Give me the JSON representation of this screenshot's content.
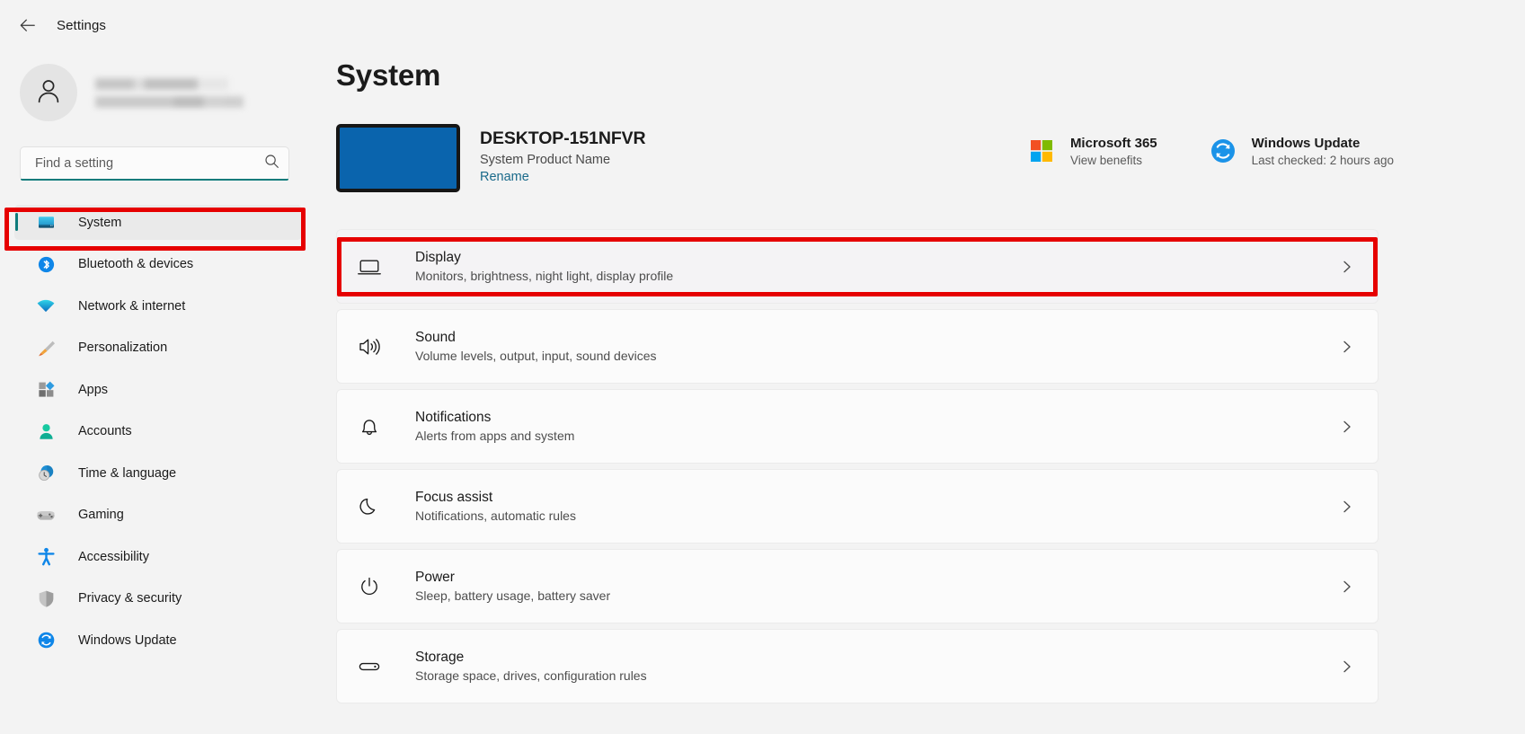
{
  "titlebar": {
    "back_icon": "back-arrow-icon",
    "title": "Settings"
  },
  "sidebar": {
    "account": {
      "avatar_icon": "person-avatar-icon",
      "name_redacted": "",
      "email_redacted": ""
    },
    "search": {
      "placeholder": "Find a setting",
      "value": "",
      "icon": "search-icon"
    },
    "items": [
      {
        "label": "System",
        "icon": "monitor-icon",
        "selected": true
      },
      {
        "label": "Bluetooth & devices",
        "icon": "bluetooth-icon",
        "selected": false
      },
      {
        "label": "Network & internet",
        "icon": "wifi-icon",
        "selected": false
      },
      {
        "label": "Personalization",
        "icon": "paintbrush-icon",
        "selected": false
      },
      {
        "label": "Apps",
        "icon": "apps-grid-icon",
        "selected": false
      },
      {
        "label": "Accounts",
        "icon": "person-icon",
        "selected": false
      },
      {
        "label": "Time & language",
        "icon": "clock-globe-icon",
        "selected": false
      },
      {
        "label": "Gaming",
        "icon": "gamepad-icon",
        "selected": false
      },
      {
        "label": "Accessibility",
        "icon": "accessibility-icon",
        "selected": false
      },
      {
        "label": "Privacy & security",
        "icon": "shield-icon",
        "selected": false
      },
      {
        "label": "Windows Update",
        "icon": "update-refresh-icon",
        "selected": false
      }
    ]
  },
  "main": {
    "page_title": "System",
    "device": {
      "thumbnail_icon": "monitor-preview-icon",
      "name": "DESKTOP-151NFVR",
      "product": "System Product Name",
      "rename_label": "Rename"
    },
    "widgets": [
      {
        "icon": "microsoft-logo-icon",
        "title": "Microsoft 365",
        "subtitle": "View benefits"
      },
      {
        "icon": "windows-update-icon",
        "title": "Windows Update",
        "subtitle": "Last checked: 2 hours ago"
      }
    ],
    "cards": [
      {
        "icon": "display-monitor-icon",
        "title": "Display",
        "subtitle": "Monitors, brightness, night light, display profile",
        "chevron": "chevron-right-icon",
        "highlighted": true
      },
      {
        "icon": "sound-speaker-icon",
        "title": "Sound",
        "subtitle": "Volume levels, output, input, sound devices",
        "chevron": "chevron-right-icon",
        "highlighted": false
      },
      {
        "icon": "notification-bell-icon",
        "title": "Notifications",
        "subtitle": "Alerts from apps and system",
        "chevron": "chevron-right-icon",
        "highlighted": false
      },
      {
        "icon": "focus-moon-icon",
        "title": "Focus assist",
        "subtitle": "Notifications, automatic rules",
        "chevron": "chevron-right-icon",
        "highlighted": false
      },
      {
        "icon": "power-icon",
        "title": "Power",
        "subtitle": "Sleep, battery usage, battery saver",
        "chevron": "chevron-right-icon",
        "highlighted": false
      },
      {
        "icon": "storage-drive-icon",
        "title": "Storage",
        "subtitle": "Storage space, drives, configuration rules",
        "chevron": "chevron-right-icon",
        "highlighted": false
      }
    ]
  },
  "annotations": [
    {
      "name": "sidebar-system-highlight",
      "color": "#e60000"
    },
    {
      "name": "display-row-highlight",
      "color": "#e60000"
    }
  ],
  "colors": {
    "accent": "#0f7b7b",
    "annotation": "#e60000",
    "page_bg": "#f3f3f3",
    "card_bg": "#fbfbfb",
    "monitor_blue": "#0a64ad",
    "link": "#1a6a8a"
  }
}
